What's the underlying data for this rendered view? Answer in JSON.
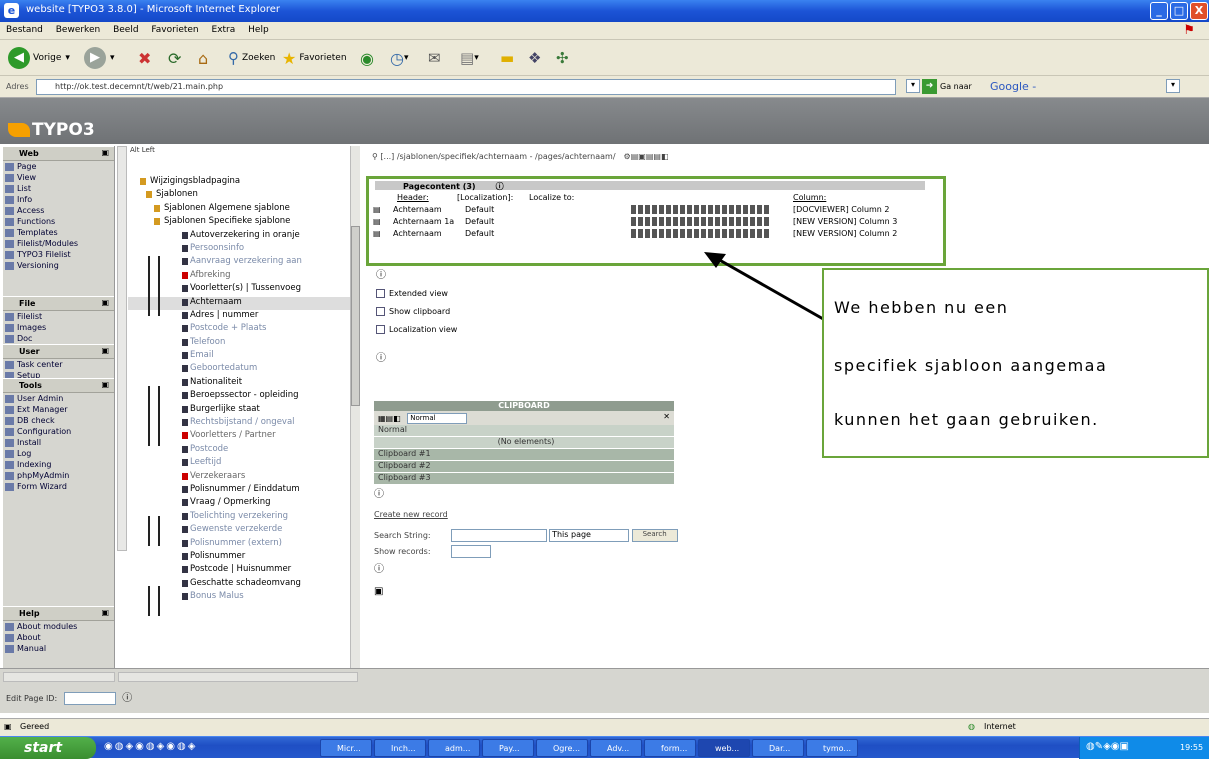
{
  "window": {
    "title": "website [TYPO3 3.8.0] - Microsoft Internet Explorer",
    "min": "_",
    "max": "□",
    "close": "X"
  },
  "menubar": [
    "Bestand",
    "Bewerken",
    "Beeld",
    "Favorieten",
    "Extra",
    "Help"
  ],
  "toolbar": {
    "back": "Vorige",
    "search": "Zoeken",
    "favorites": "Favorieten"
  },
  "address": {
    "label": "Adres",
    "url": "http://ok.test.decemnt/t/web/21.main.php",
    "go": "Ga naar",
    "google": "Google -"
  },
  "typo3": {
    "logo": "TYPO3"
  },
  "modules": [
    {
      "group": "Web",
      "items": [
        "Page",
        "View",
        "List",
        "Info",
        "Access",
        "Functions",
        "Templates",
        "Filelist/Modules",
        "TYPO3 Filelist",
        "Versioning"
      ]
    },
    {
      "group": "File",
      "items": [
        "Filelist",
        "Images",
        "Doc"
      ]
    },
    {
      "group": "User",
      "items": [
        "Task center",
        "Setup"
      ]
    },
    {
      "group": "Tools",
      "items": [
        "User Admin",
        "Ext Manager",
        "DB check",
        "Configuration",
        "Install",
        "Log",
        "Indexing",
        "phpMyAdmin",
        "Form Wizard"
      ]
    },
    {
      "group": "Help",
      "items": [
        "About modules",
        "About",
        "Manual"
      ]
    }
  ],
  "tree": {
    "header": "Alt Left",
    "nodes": [
      {
        "label": "Wijzigingsbladpagina",
        "type": "root"
      },
      {
        "label": "Sjablonen",
        "type": "folder"
      },
      {
        "label": "Sjablonen  Algemene sjablone",
        "type": "folder"
      },
      {
        "label": "Sjablonen  Specifieke sjablone",
        "type": "folder"
      },
      {
        "label": "Autoverzekering in oranje",
        "type": "doc"
      },
      {
        "label": "Persoonsinfo",
        "type": "faint"
      },
      {
        "label": "Aanvraag verzekering aan",
        "type": "faint"
      },
      {
        "label": "Afbreking",
        "type": "red"
      },
      {
        "label": "Voorletter(s) | Tussenvoeg",
        "type": "doc"
      },
      {
        "label": "Achternaam",
        "type": "highlight"
      },
      {
        "label": "Adres | nummer",
        "type": "doc"
      },
      {
        "label": "Postcode + Plaats",
        "type": "faint"
      },
      {
        "label": "Telefoon",
        "type": "faint"
      },
      {
        "label": "Email",
        "type": "faint"
      },
      {
        "label": "Geboortedatum",
        "type": "faint"
      },
      {
        "label": "Nationaliteit",
        "type": "doc"
      },
      {
        "label": "Beroepssector - opleiding",
        "type": "doc"
      },
      {
        "label": "Burgerlijke staat",
        "type": "doc"
      },
      {
        "label": "Rechtsbijstand / ongeval",
        "type": "faint"
      },
      {
        "label": "Voorletters / Partner",
        "type": "red"
      },
      {
        "label": "Postcode",
        "type": "faint"
      },
      {
        "label": "Leeftijd",
        "type": "faint"
      },
      {
        "label": "Verzekeraars",
        "type": "red"
      },
      {
        "label": "Polisnummer / Einddatum",
        "type": "doc"
      },
      {
        "label": "Vraag / Opmerking",
        "type": "doc"
      },
      {
        "label": "Toelichting verzekering",
        "type": "faint"
      },
      {
        "label": "Gewenste verzekerde",
        "type": "faint"
      },
      {
        "label": "Polisnummer (extern)",
        "type": "faint"
      },
      {
        "label": "Polisnummer",
        "type": "doc"
      },
      {
        "label": "Postcode | Huisnummer",
        "type": "doc"
      },
      {
        "label": "Geschatte schadeomvang",
        "type": "doc"
      },
      {
        "label": "Bonus Malus",
        "type": "faint"
      }
    ]
  },
  "content": {
    "breadcrumb": "[...] /sjablonen/specifiek/achternaam - /pages/achternaam/",
    "pagecontent": {
      "title": "Pagecontent (3)",
      "header_col": "Header:",
      "loc_col": "[Localization]:",
      "localize": "Localize to:",
      "col_col": "Column:",
      "rows": [
        {
          "header": "Achternaam",
          "loc": "Default",
          "col": "[DOCVIEWER] Column 2"
        },
        {
          "header": "Achternaam 1a",
          "loc": "Default",
          "col": "[NEW VERSION] Column 3"
        },
        {
          "header": "Achternaam",
          "loc": "Default",
          "col": "[NEW VERSION] Column 2"
        }
      ]
    },
    "options": [
      "Extended view",
      "Show clipboard",
      "Localization view"
    ],
    "clipboard": {
      "title": "CLIPBOARD",
      "normal": "Normal",
      "nothing": "(No elements)",
      "items": [
        "Clipboard #1",
        "Clipboard #2",
        "Clipboard #3"
      ],
      "select": "Normal"
    },
    "create_link": "Create new record",
    "search": {
      "label": "Search String:",
      "scope": "This page",
      "button": "Search",
      "show_label": "Show records:"
    }
  },
  "callout": {
    "line1": "We      hebben      nu      een",
    "line2": "specifiek sjabloon aangemaa",
    "line3": "kunnen het gaan gebruiken."
  },
  "bottom": {
    "page_id_label": "Edit Page ID:"
  },
  "status": {
    "left": "Gereed",
    "zone": "Internet"
  },
  "taskbar": {
    "start": "start",
    "tasks": [
      "Micr...",
      "Inch...",
      "adm...",
      "Pay...",
      "Ogre...",
      "Adv...",
      "form...",
      "web...",
      "Dar...",
      "tymo..."
    ],
    "clock": "19:55"
  }
}
